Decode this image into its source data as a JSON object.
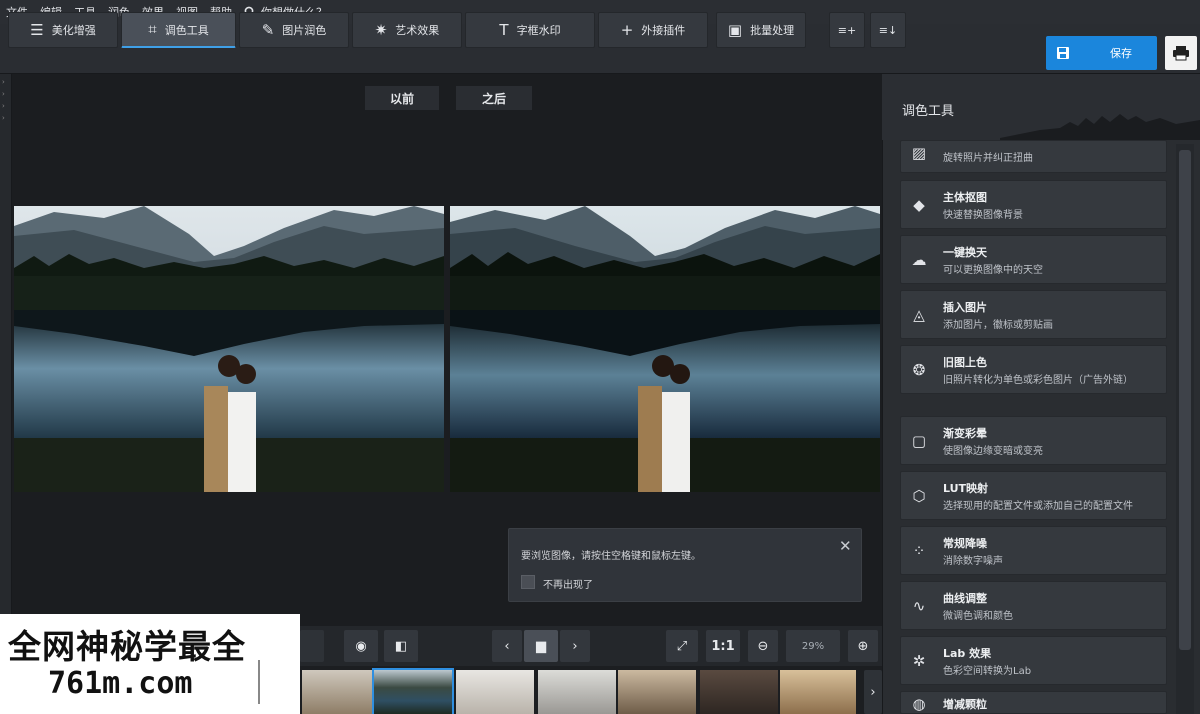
{
  "menubar": {
    "items": [
      "文件",
      "编辑",
      "工具",
      "润色",
      "效果",
      "视图",
      "帮助"
    ],
    "search_placeholder": "你想做什么？"
  },
  "toolbar": {
    "tabs": [
      {
        "label": "美化增强",
        "icon": "sliders-icon"
      },
      {
        "label": "调色工具",
        "icon": "crop-icon"
      },
      {
        "label": "图片润色",
        "icon": "brush-icon"
      },
      {
        "label": "艺术效果",
        "icon": "magic-wand-icon"
      },
      {
        "label": "字框水印",
        "icon": "text-icon"
      },
      {
        "label": "外接插件",
        "icon": "plus-icon"
      },
      {
        "label": "批量处理",
        "icon": "image-stack-icon"
      }
    ],
    "save_label": "保存"
  },
  "compare": {
    "before": "以前",
    "after": "之后"
  },
  "tip": {
    "message": "要浏览图像，请按住空格键和鼠标左键。",
    "checkbox_label": "不再出现了"
  },
  "bottom": {
    "ratio_label": "1:1",
    "zoom_value": "29%"
  },
  "panel": {
    "title": "调色工具",
    "items": [
      {
        "title": "",
        "desc": "旋转照片并纠正扭曲",
        "icon": "rotate-icon"
      },
      {
        "title": "主体抠图",
        "desc": "快速替换图像背景",
        "icon": "bucket-icon"
      },
      {
        "title": "一键换天",
        "desc": "可以更换图像中的天空",
        "icon": "cloud-icon"
      },
      {
        "title": "插入图片",
        "desc": "添加图片，徽标或剪贴画",
        "icon": "insert-image-icon"
      },
      {
        "title": "旧图上色",
        "desc": "旧照片转化为单色或彩色图片（广告外链）",
        "icon": "palette-icon"
      },
      {
        "title": "渐变彩晕",
        "desc": "使图像边缘变暗或变亮",
        "icon": "vignette-icon"
      },
      {
        "title": "LUT映射",
        "desc": "选择现用的配置文件或添加自己的配置文件",
        "icon": "cube-icon"
      },
      {
        "title": "常规降噪",
        "desc": "消除数字噪声",
        "icon": "noise-icon"
      },
      {
        "title": "曲线调整",
        "desc": "微调色调和颜色",
        "icon": "curve-icon"
      },
      {
        "title": "Lab 效果",
        "desc": "色彩空间转换为Lab",
        "icon": "aperture-icon"
      },
      {
        "title": "增减颗粒",
        "desc": "",
        "icon": "grain-icon"
      }
    ]
  },
  "watermark": {
    "line1": "全网神秘学最全",
    "line2": "761m.com"
  }
}
